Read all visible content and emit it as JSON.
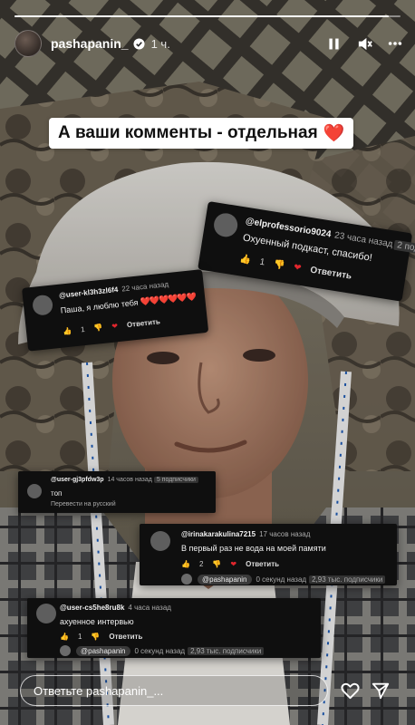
{
  "story": {
    "username": "pashapanin_",
    "time": "1 ч.",
    "progress_fraction": 0.97,
    "caption": "А ваши комменты - отдельная",
    "caption_emoji": "❤️"
  },
  "comments": [
    {
      "handle": "@elprofessorio9024",
      "time": "23 часа назад",
      "text": "Охуенный подкаст, спасибо!",
      "likes": "1",
      "reply": "Ответить"
    },
    {
      "handle": "@user-kl3h3zl6f4",
      "time": "22 часа назад",
      "text": "Паша, я люблю тебя",
      "hearts": "❤️❤️❤️❤️❤️❤️",
      "likes": "1",
      "reply": "Ответить"
    },
    {
      "handle": "@user-gj3pfdw3p",
      "time": "14 часов назад",
      "text": "топ",
      "translate": "Перевести на русский"
    },
    {
      "handle": "@irinakarakulina7215",
      "time": "17 часов назад",
      "text": "В первый раз не вода на моей памяти",
      "likes": "2",
      "reply": "Ответить",
      "reply_author": "@pashapanin",
      "reply_time": "0 секунд назад",
      "reply_subs": "2,93 тыс. подписчики"
    },
    {
      "handle": "@user-cs5he8ru8k",
      "time": "4 часа назад",
      "text": "ахуенное интервью",
      "likes": "1",
      "reply": "Ответить",
      "reply_author": "@pashapanin",
      "reply_time": "0 секунд назад",
      "reply_subs": "2,93 тыс. подписчики"
    }
  ],
  "footer": {
    "reply_placeholder": "Ответьте pashapanin_..."
  },
  "colors": {
    "heart": "#e0262d",
    "card_bg": "#0f0f0f"
  },
  "icons": [
    "verified-badge-icon",
    "pause-icon",
    "mute-icon",
    "more-icon",
    "heart-icon",
    "send-icon",
    "thumb-up-icon",
    "thumb-down-icon"
  ]
}
